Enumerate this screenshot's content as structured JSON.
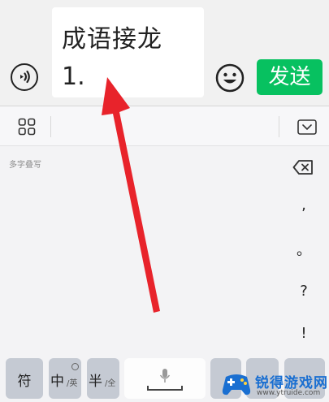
{
  "chat": {
    "input_line1": "成语接龙",
    "input_line2": "1.",
    "send_label": "发送"
  },
  "keyboard": {
    "handwrite_hint": "多字叠写",
    "side_keys": [
      ",",
      "。",
      "?",
      "!"
    ],
    "bottom": {
      "symbol_label": "符",
      "chinese_label": "中",
      "chinese_sub": "/英",
      "half_label": "半",
      "half_sub": "/全"
    }
  },
  "watermark": {
    "title": "锐得游戏网",
    "url": "www.ytruide.com"
  },
  "colors": {
    "send_button": "#07c160",
    "arrow": "#e8232b",
    "watermark_blue": "#1a6fd1"
  }
}
